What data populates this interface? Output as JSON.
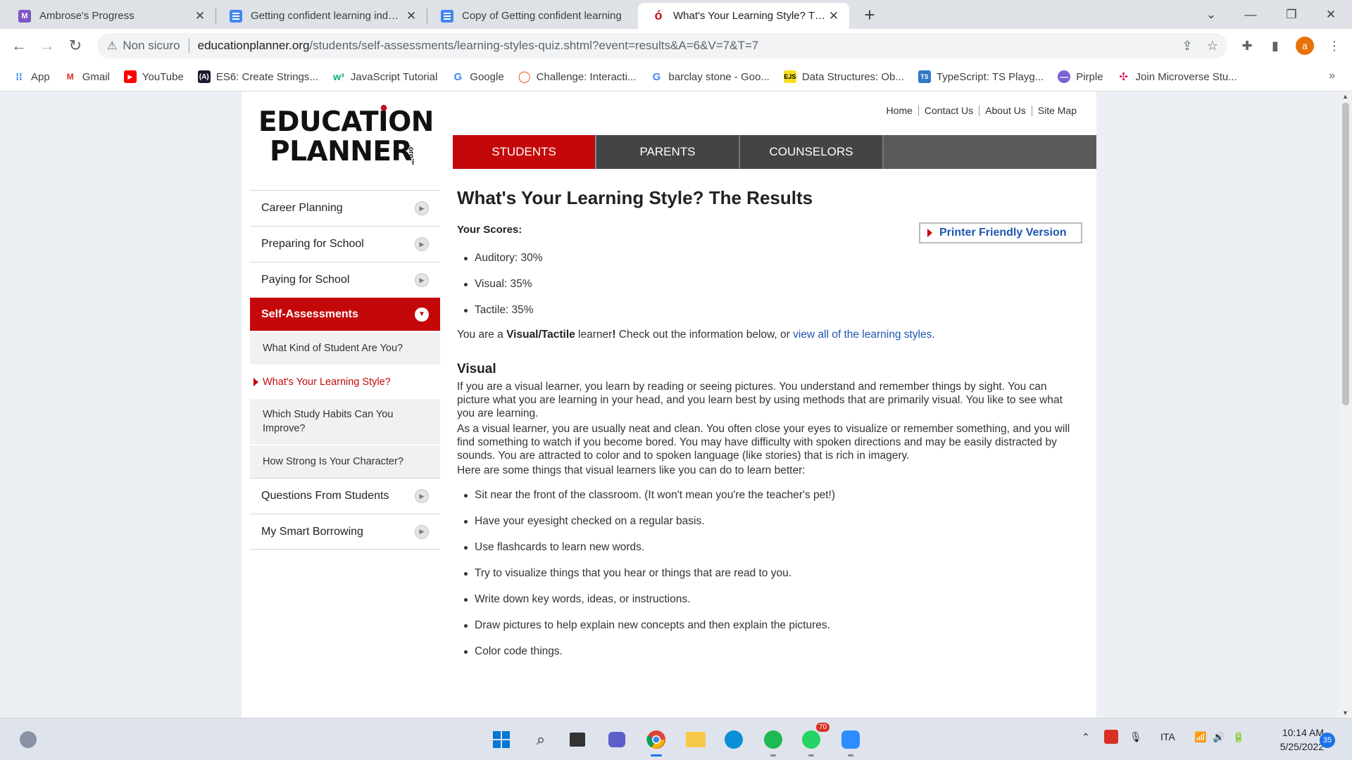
{
  "browser": {
    "tabs": [
      {
        "title": "Ambrose's Progress",
        "icon": "ambrose-icon"
      },
      {
        "title": "Getting confident learning independently",
        "icon": "docs-icon"
      },
      {
        "title": "Copy of Getting confident learning",
        "icon": "docs-icon"
      },
      {
        "title": "What's Your Learning Style? The Results",
        "icon": "apple-icon"
      }
    ],
    "new_tab": "+",
    "window_controls": {
      "minimize": "—",
      "restore": "❐",
      "close": "✕",
      "tab_search": "⌄"
    },
    "address": {
      "security_label": "Non sicuro",
      "host": "educationplanner.org",
      "path": "/students/self-assessments/learning-styles-quiz.shtml?event=results&A=6&V=7&T=7"
    },
    "profile_initial": "a",
    "bookmarks": [
      {
        "label": "App",
        "icon": "apps-grid-icon"
      },
      {
        "label": "Gmail",
        "icon": "gmail-icon"
      },
      {
        "label": "YouTube",
        "icon": "youtube-icon"
      },
      {
        "label": "ES6: Create Strings...",
        "icon": "freecodecamp-icon"
      },
      {
        "label": "JavaScript Tutorial",
        "icon": "w3schools-icon"
      },
      {
        "label": "Google",
        "icon": "google-icon"
      },
      {
        "label": "Challenge: Interacti...",
        "icon": "khan-icon"
      },
      {
        "label": "barclay stone - Goo...",
        "icon": "google-icon"
      },
      {
        "label": "Data Structures: Ob...",
        "icon": "ejs-icon"
      },
      {
        "label": "TypeScript: TS Playg...",
        "icon": "typescript-icon"
      },
      {
        "label": "Pirple",
        "icon": "pirple-icon"
      },
      {
        "label": "Join Microverse Stu...",
        "icon": "slack-icon"
      }
    ],
    "bookmarks_more": "»"
  },
  "site": {
    "logo": {
      "line1": "EDUCATION",
      "line2": "PLANNER",
      "suffix": ".org™"
    },
    "top_links": [
      "Home",
      "Contact Us",
      "About Us",
      "Site Map"
    ],
    "main_nav": [
      "STUDENTS",
      "PARENTS",
      "COUNSELORS"
    ],
    "sidebar": {
      "items_top": [
        "Career Planning",
        "Preparing for School",
        "Paying for School"
      ],
      "active": "Self-Assessments",
      "sub_items": [
        "What Kind of Student Are You?",
        "What's Your Learning Style?",
        "Which Study Habits Can You Improve?",
        "How Strong Is Your Character?"
      ],
      "items_bottom": [
        "Questions From Students",
        "My Smart Borrowing"
      ]
    }
  },
  "content": {
    "title": "What's Your Learning Style? The Results",
    "scores_label": "Your Scores:",
    "printer_label": "Printer Friendly Version",
    "scores": [
      "Auditory: 30%",
      "Visual: 35%",
      "Tactile: 35%"
    ],
    "result": {
      "pre": "You are a ",
      "style": "Visual/Tactile",
      "mid": " learner",
      "bang": "!",
      "post": " Check out the information below, or ",
      "link": "view all of the learning styles",
      "end": "."
    },
    "section_title": "Visual",
    "para1": "If you are a visual learner, you learn by reading or seeing pictures. You understand and remember things by sight. You can picture what you are learning in your head, and you learn best by using methods that are primarily visual. You like to see what you are learning.",
    "para2": "As a visual learner, you are usually neat and clean. You often close your eyes to visualize or remember something, and you will find something to watch if you become bored. You may have difficulty with spoken directions and may be easily distracted by sounds. You are attracted to color and to spoken language (like stories) that is rich in imagery.",
    "para3": "Here are some things that visual learners like you can do to learn better:",
    "tips": [
      "Sit near the front of the classroom. (It won't mean you're the teacher's pet!)",
      "Have your eyesight checked on a regular basis.",
      "Use flashcards to learn new words.",
      "Try to visualize things that you hear or things that are read to you.",
      "Write down key words, ideas, or instructions.",
      "Draw pictures to help explain new concepts and then explain the pictures.",
      "Color code things."
    ]
  },
  "taskbar": {
    "apps": [
      "start-icon",
      "search-icon",
      "task-view-icon",
      "chat-icon",
      "chrome-icon",
      "file-explorer-icon",
      "edge-icon",
      "spotify-icon",
      "whatsapp-icon",
      "zoom-icon"
    ],
    "whatsapp_badge": "70",
    "language": "ITA",
    "time": "10:14 AM",
    "date": "5/25/2022",
    "notifications": "35"
  }
}
